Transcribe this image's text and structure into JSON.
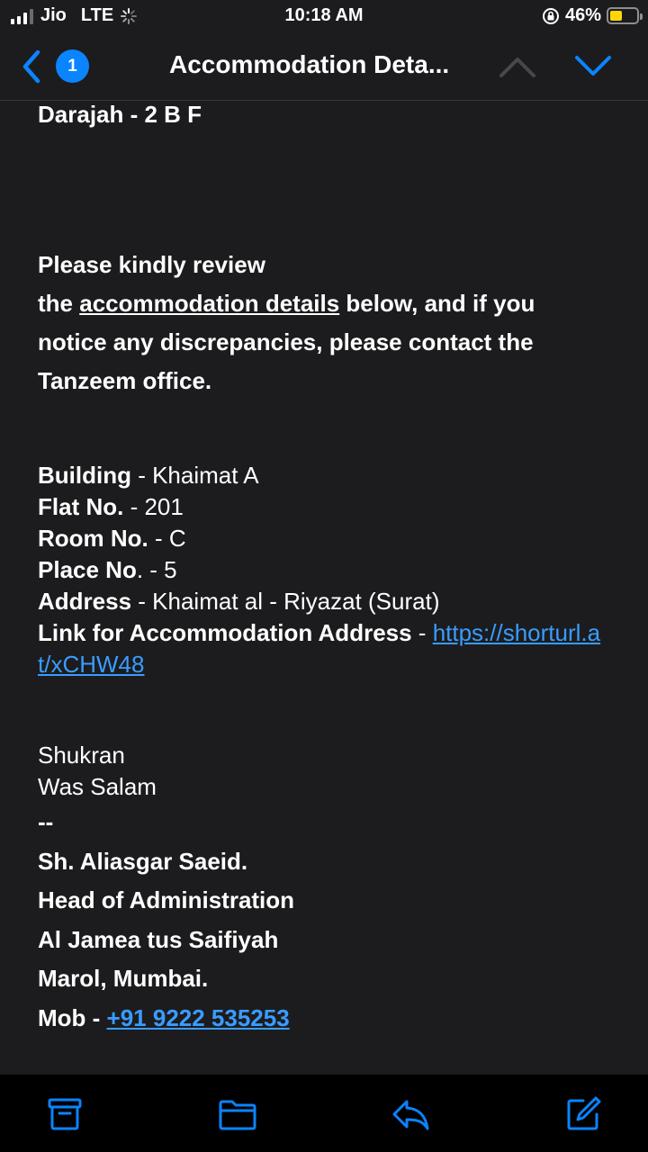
{
  "status": {
    "carrier": "Jio",
    "network": "LTE",
    "time": "10:18 AM",
    "battery_percent": "46%",
    "battery_level": 0.46,
    "battery_color": "#ffd60a",
    "signal_bars_active": 3
  },
  "nav": {
    "unread_count": "1",
    "title": "Accommodation Deta...",
    "back_icon": "chevron-left-icon",
    "prev_icon": "chevron-up-icon",
    "next_icon": "chevron-down-icon",
    "accent": "#0a84ff"
  },
  "email": {
    "darajah": "Darajah - 2 B F",
    "intro_line1": "Please kindly review",
    "intro_the": "the ",
    "intro_link": "accommodation details",
    "intro_rest": " below, and if you notice any discrepancies, please contact the Tanzeem office.",
    "details": [
      {
        "label": "Building",
        "sep": " - ",
        "value": "Khaimat A"
      },
      {
        "label": "Flat No.",
        "sep": " - ",
        "value": "201"
      },
      {
        "label": "Room No.",
        "sep": " - ",
        "value": "C"
      },
      {
        "label": "Place No",
        "sep": ". - ",
        "value": "5"
      },
      {
        "label": "Address",
        "sep": " - ",
        "value": "Khaimat al - Riyazat (Surat)"
      }
    ],
    "link_label": "Link for Accommodation Address",
    "link_sep": " - ",
    "link_url": "https://shorturl.at/xCHW48",
    "closing1": "Shukran",
    "closing2": "Was Salam",
    "sig_sep": "--",
    "signature": {
      "name": "Sh. Aliasgar Saeid.",
      "role": "Head of Administration",
      "org": "Al Jamea tus Saifiyah",
      "location": "Marol, Mumbai.",
      "mob_label": "Mob - ",
      "mob": "+91 9222 535253"
    }
  },
  "toolbar": {
    "archive_icon": "archive-icon",
    "folder_icon": "folder-icon",
    "reply_icon": "reply-icon",
    "compose_icon": "compose-icon"
  },
  "link_color": "#3a9cff"
}
